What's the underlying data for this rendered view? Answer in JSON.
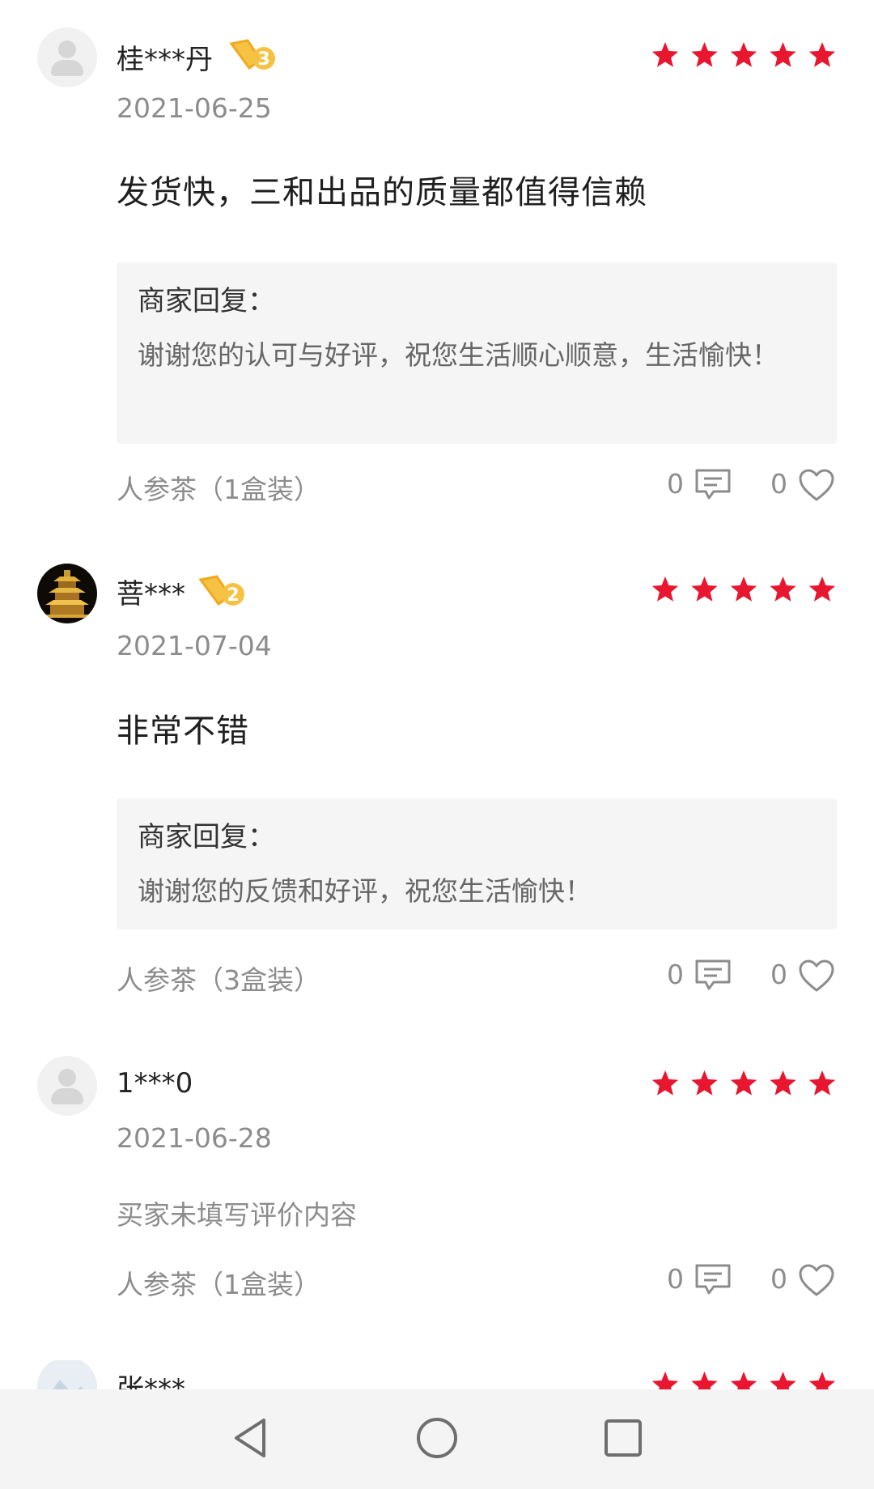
{
  "reviews": [
    {
      "user": "桂***丹",
      "vip_level": "3",
      "avatar": "default-user-icon",
      "rating": 5,
      "date": "2021-06-25",
      "content": "发货快，三和出品的质量都值得信赖",
      "reply_label": "商家回复：",
      "reply_text": "谢谢您的认可与好评，祝您生活顺心顺意，生活愉快！",
      "variant": "人参茶（1盒装）",
      "comments": "0",
      "likes": "0"
    },
    {
      "user": "菩***",
      "vip_level": "2",
      "avatar": "pagoda-photo",
      "rating": 5,
      "date": "2021-07-04",
      "content": "非常不错",
      "reply_label": "商家回复：",
      "reply_text": "谢谢您的反馈和好评，祝您生活愉快！",
      "variant": "人参茶（3盒装）",
      "comments": "0",
      "likes": "0"
    },
    {
      "user": "1***0",
      "avatar": "default-user-icon",
      "rating": 5,
      "date": "2021-06-28",
      "content": "买家未填写评价内容",
      "variant": "人参茶（1盒装）",
      "comments": "0",
      "likes": "0"
    },
    {
      "user": "张***",
      "avatar": "landscape-photo",
      "rating": 5
    }
  ],
  "colors": {
    "star": "#e8162f",
    "vip_badge": "#f6c244",
    "muted_text": "#8c8c8c",
    "reply_bg": "#f5f5f5"
  },
  "navbar": {
    "buttons": [
      "back-triangle-icon",
      "home-circle-icon",
      "recents-square-icon"
    ]
  }
}
